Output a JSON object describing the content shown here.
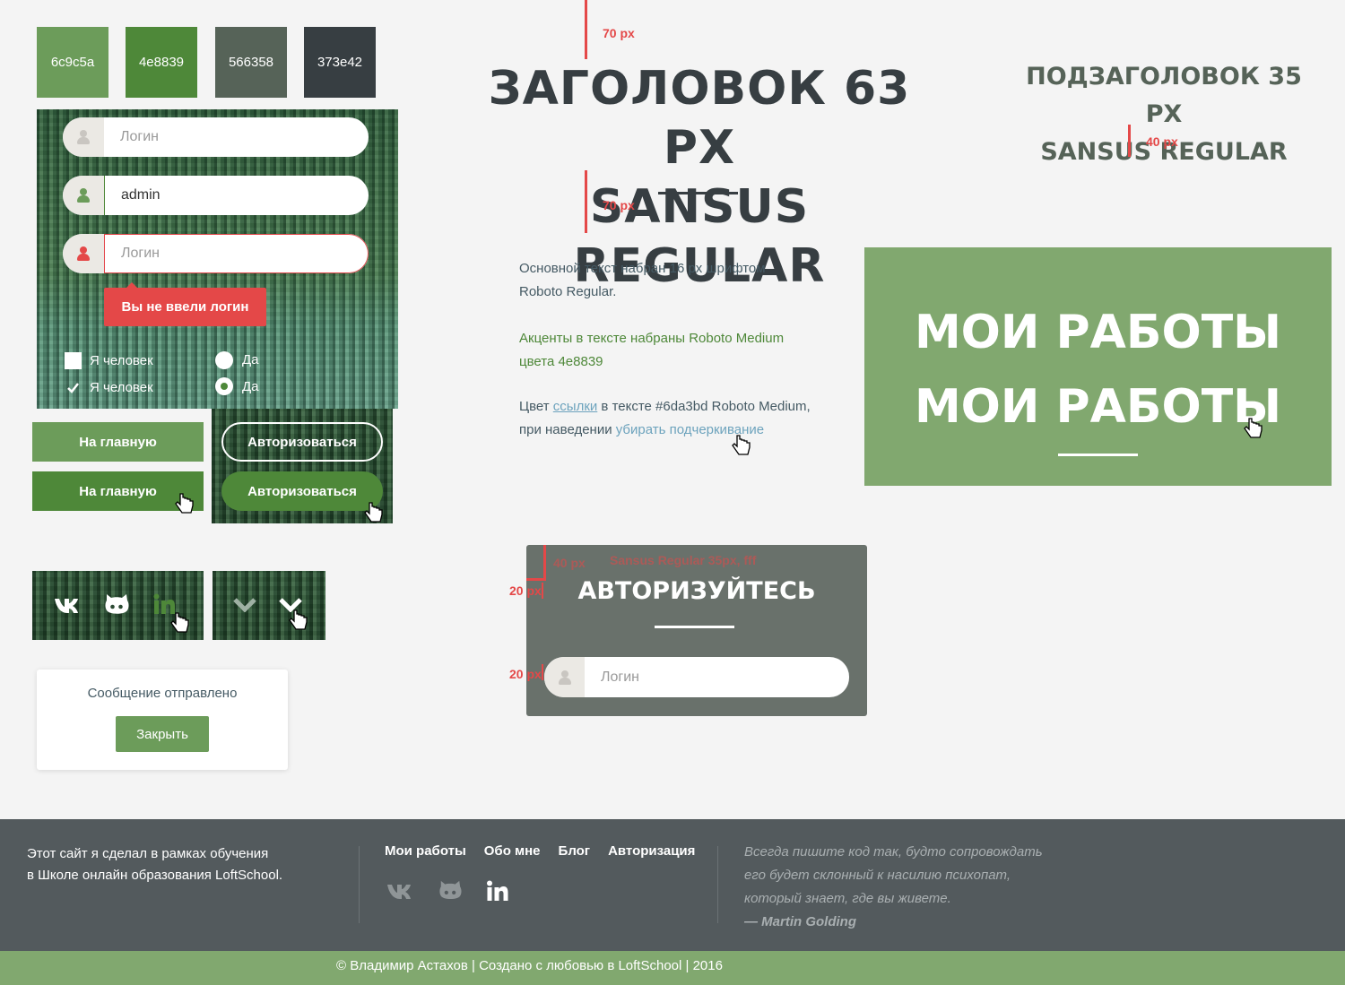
{
  "swatches": [
    {
      "label": "6c9c5a",
      "color": "#6c9c5a"
    },
    {
      "label": "4e8839",
      "color": "#4e8839"
    },
    {
      "label": "566358",
      "color": "#566358"
    },
    {
      "label": "373e42",
      "color": "#373e42"
    }
  ],
  "login_form": {
    "input1_placeholder": "Логин",
    "input2_value": "admin",
    "input3_placeholder": "Логин",
    "error_tooltip": "Вы не ввели логин",
    "checkbox_label_1": "Я человек",
    "checkbox_label_2": "Я человек",
    "radio_label_1": "Да",
    "radio_label_2": "Да"
  },
  "buttons": {
    "home": "На главную",
    "home_hover": "На главную",
    "authorize": "Авторизоваться",
    "authorize_hover": "Авторизоваться"
  },
  "social": {
    "vk": "vk-icon",
    "github": "github-icon",
    "linkedin": "linkedin-icon",
    "arrow_down": "chevron-down-icon"
  },
  "modal": {
    "message": "Сообщение отправлено",
    "close": "Закрыть"
  },
  "typography": {
    "heading_line1": "ЗАГОЛОВОК 63 PX",
    "heading_line2": "SANSUS REGULAR",
    "heading_spacing_top": "70 px",
    "heading_spacing_bottom": "70 px",
    "subheading_line1": "ПОДЗАГОЛОВОК 35 PX",
    "subheading_line2": "SANSUS REGULAR",
    "subheading_spacing": "40 px",
    "body_p1": "Основной текст набран 16 px шрифтом",
    "body_p1b": "Roboto Regular.",
    "accent_p1": "Акценты в тексте набраны Roboto Medium",
    "accent_p1b": "цвета 4e8839",
    "link_pre": "Цвет ",
    "link_word": "ссылки",
    "link_post": " в тексте #6da3bd Roboto Medium,",
    "link_line2_pre": "при наведении ",
    "link_line2_hover": "убирать подчеркивание"
  },
  "banner": {
    "line1": "МОИ РАБОТЫ",
    "line2": "МОИ РАБОТЫ"
  },
  "auth_panel": {
    "spec_note": "Sansus Regular 35px, fff",
    "spec_40": "40 px",
    "spec_20a": "20 px",
    "spec_20b": "20 px",
    "title": "АВТОРИЗУЙТЕСЬ",
    "input_placeholder": "Логин"
  },
  "footer": {
    "about_line1": "Этот сайт я сделал в рамках обучения",
    "about_line2": "в Школе онлайн образования LoftSchool.",
    "nav": [
      "Мои работы",
      "Обо мне",
      "Блог",
      "Авторизация"
    ],
    "quote_line1": "Всегда пишите код так, будто сопровождать",
    "quote_line2": "его будет склонный к насилию психопат,",
    "quote_line3": "который знает, где вы живете.",
    "quote_author": "— Martin Golding",
    "copyright": "© Владимир Астахов | Создано с любовью в LoftSchool | 2016"
  },
  "colors": {
    "accent": "#4e8839",
    "accent_light": "#6c9c5a",
    "link": "#6da3bd",
    "error": "#e44848",
    "dark": "#373e42",
    "footer_bg": "#535a5d",
    "banner_bg": "#81a86f"
  }
}
